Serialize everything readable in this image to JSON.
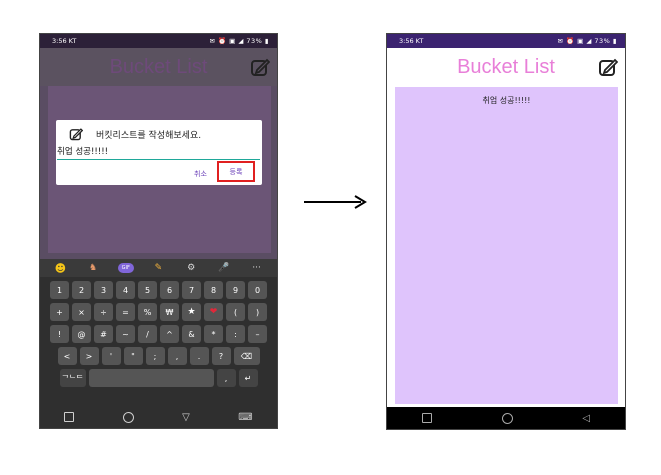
{
  "left_screen": {
    "status": {
      "time": "3:56 KT",
      "battery": "73%"
    },
    "app_title": "Bucket List",
    "dialog": {
      "title": "버킷리스트를 작성해보세요.",
      "input_value": "취업 성공!!!!!",
      "cancel_label": "취소",
      "register_label": "등록"
    },
    "keyboard": {
      "toolbar": [
        "emoji-icon",
        "sticker-icon",
        "gif-icon",
        "pencil-icon",
        "settings-icon",
        "mic-icon",
        "more-icon"
      ],
      "gif_label": "GIF",
      "more_label": "···",
      "rows": [
        [
          "1",
          "2",
          "3",
          "4",
          "5",
          "6",
          "7",
          "8",
          "9",
          "0"
        ],
        [
          "+",
          "×",
          "÷",
          "=",
          "%",
          "₩",
          "★",
          "❤",
          "(",
          ")"
        ],
        [
          "!",
          "@",
          "#",
          "~",
          "/",
          "^",
          "&",
          "*",
          ":",
          "–"
        ],
        [
          "<",
          ">",
          "'",
          "\"",
          ";",
          ",",
          ".",
          "?",
          "⌫"
        ]
      ],
      "bottom_left": "ᄀᄂᄃ",
      "bottom_comma": ",",
      "bottom_enter": "↵"
    },
    "accent_highlight": "#e02020"
  },
  "right_screen": {
    "status": {
      "time": "3:56 KT",
      "battery": "73%"
    },
    "app_title": "Bucket List",
    "items": [
      "취업 성공!!!!!"
    ],
    "title_color": "#e87fd8",
    "list_bg": "#dfc4fc"
  },
  "arrow": "right-arrow"
}
